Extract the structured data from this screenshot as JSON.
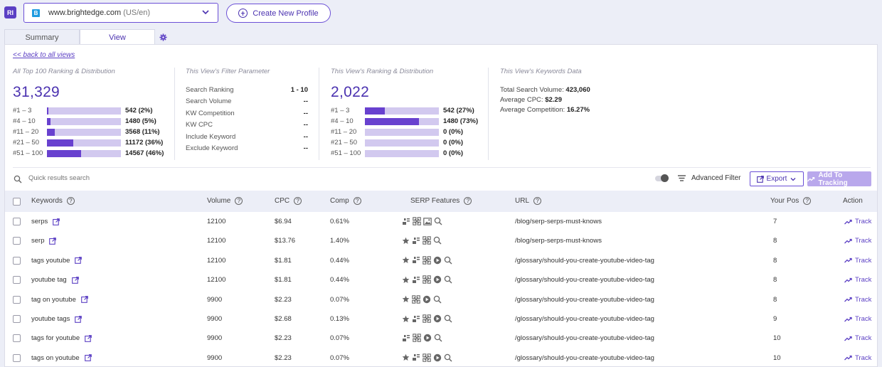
{
  "header": {
    "badge": "RI",
    "profile_logo": "B",
    "profile_domain": "www.brightedge.com",
    "profile_region": "(US/en)",
    "create_button": "Create New Profile"
  },
  "tabs": [
    {
      "label": "Summary",
      "active": false
    },
    {
      "label": "View",
      "active": true
    }
  ],
  "back_link": "<< back to all views",
  "all_top100": {
    "title": "All Top 100 Ranking & Distribution",
    "total": "31,329",
    "rows": [
      {
        "label": "#1 – 3",
        "value": "542 (2%)",
        "share": 0.02
      },
      {
        "label": "#4 – 10",
        "value": "1480 (5%)",
        "share": 0.05
      },
      {
        "label": "#11 – 20",
        "value": "3568 (11%)",
        "share": 0.11
      },
      {
        "label": "#21 – 50",
        "value": "11172 (36%)",
        "share": 0.36
      },
      {
        "label": "#51 – 100",
        "value": "14567 (46%)",
        "share": 0.46
      }
    ]
  },
  "filter_params": {
    "title": "This View's Filter Parameter",
    "rows": [
      {
        "label": "Search Ranking",
        "value": "1 - 10"
      },
      {
        "label": "Search Volume",
        "value": "--"
      },
      {
        "label": "KW Competition",
        "value": "--"
      },
      {
        "label": "KW CPC",
        "value": "--"
      },
      {
        "label": "Include Keyword",
        "value": "--"
      },
      {
        "label": "Exclude Keyword",
        "value": "--"
      }
    ]
  },
  "view_dist": {
    "title": "This View's Ranking & Distribution",
    "total": "2,022",
    "rows": [
      {
        "label": "#1 – 3",
        "value": "542 (27%)",
        "share": 0.27
      },
      {
        "label": "#4 – 10",
        "value": "1480 (73%)",
        "share": 0.73
      },
      {
        "label": "#11 – 20",
        "value": "0 (0%)",
        "share": 0
      },
      {
        "label": "#21 – 50",
        "value": "0 (0%)",
        "share": 0
      },
      {
        "label": "#51 – 100",
        "value": "0 (0%)",
        "share": 0
      }
    ]
  },
  "kw_data": {
    "title": "This View's Keywords Data",
    "volume_label": "Total Search Volume:",
    "volume_value": "423,060",
    "cpc_label": "Average CPC:",
    "cpc_value": "$2.29",
    "comp_label": "Average Competition:",
    "comp_value": "16.27%"
  },
  "toolbar": {
    "search_placeholder": "Quick results search",
    "advanced_filter": "Advanced Filter",
    "export": "Export",
    "add_tracking": "Add To Tracking"
  },
  "columns": {
    "keywords": "Keywords",
    "volume": "Volume",
    "cpc": "CPC",
    "comp": "Comp",
    "serp": "SERP Features",
    "url": "URL",
    "pos": "Your Pos",
    "action": "Action"
  },
  "rows": [
    {
      "keyword": "serps",
      "volume": "12100",
      "cpc": "$6.94",
      "comp": "0.61%",
      "serp": [
        "snippet",
        "carousel",
        "image",
        "search"
      ],
      "url": "/blog/serp-serps-must-knows",
      "pos": "7",
      "action": "Track"
    },
    {
      "keyword": "serp",
      "volume": "12100",
      "cpc": "$13.76",
      "comp": "1.40%",
      "serp": [
        "star",
        "snippet",
        "carousel",
        "search"
      ],
      "url": "/blog/serp-serps-must-knows",
      "pos": "8",
      "action": "Track"
    },
    {
      "keyword": "tags youtube",
      "volume": "12100",
      "cpc": "$1.81",
      "comp": "0.44%",
      "serp": [
        "star",
        "snippet",
        "carousel",
        "video",
        "search"
      ],
      "url": "/glossary/should-you-create-youtube-video-tag",
      "pos": "8",
      "action": "Track"
    },
    {
      "keyword": "youtube tag",
      "volume": "12100",
      "cpc": "$1.81",
      "comp": "0.44%",
      "serp": [
        "star",
        "snippet",
        "carousel",
        "video",
        "search"
      ],
      "url": "/glossary/should-you-create-youtube-video-tag",
      "pos": "8",
      "action": "Track"
    },
    {
      "keyword": "tag on youtube",
      "volume": "9900",
      "cpc": "$2.23",
      "comp": "0.07%",
      "serp": [
        "star",
        "carousel",
        "video",
        "search"
      ],
      "url": "/glossary/should-you-create-youtube-video-tag",
      "pos": "8",
      "action": "Track"
    },
    {
      "keyword": "youtube tags",
      "volume": "9900",
      "cpc": "$2.68",
      "comp": "0.13%",
      "serp": [
        "star",
        "snippet",
        "carousel",
        "video",
        "search"
      ],
      "url": "/glossary/should-you-create-youtube-video-tag",
      "pos": "9",
      "action": "Track"
    },
    {
      "keyword": "tags for youtube",
      "volume": "9900",
      "cpc": "$2.23",
      "comp": "0.07%",
      "serp": [
        "snippet",
        "carousel",
        "video",
        "search"
      ],
      "url": "/glossary/should-you-create-youtube-video-tag",
      "pos": "10",
      "action": "Track"
    },
    {
      "keyword": "tags on youtube",
      "volume": "9900",
      "cpc": "$2.23",
      "comp": "0.07%",
      "serp": [
        "star",
        "snippet",
        "carousel",
        "video",
        "search"
      ],
      "url": "/glossary/should-you-create-youtube-video-tag",
      "pos": "10",
      "action": "Track"
    }
  ],
  "colors": {
    "accent": "#5b3fc4",
    "bar_fill": "#6841cf",
    "bar_track": "#d2c9ef"
  }
}
